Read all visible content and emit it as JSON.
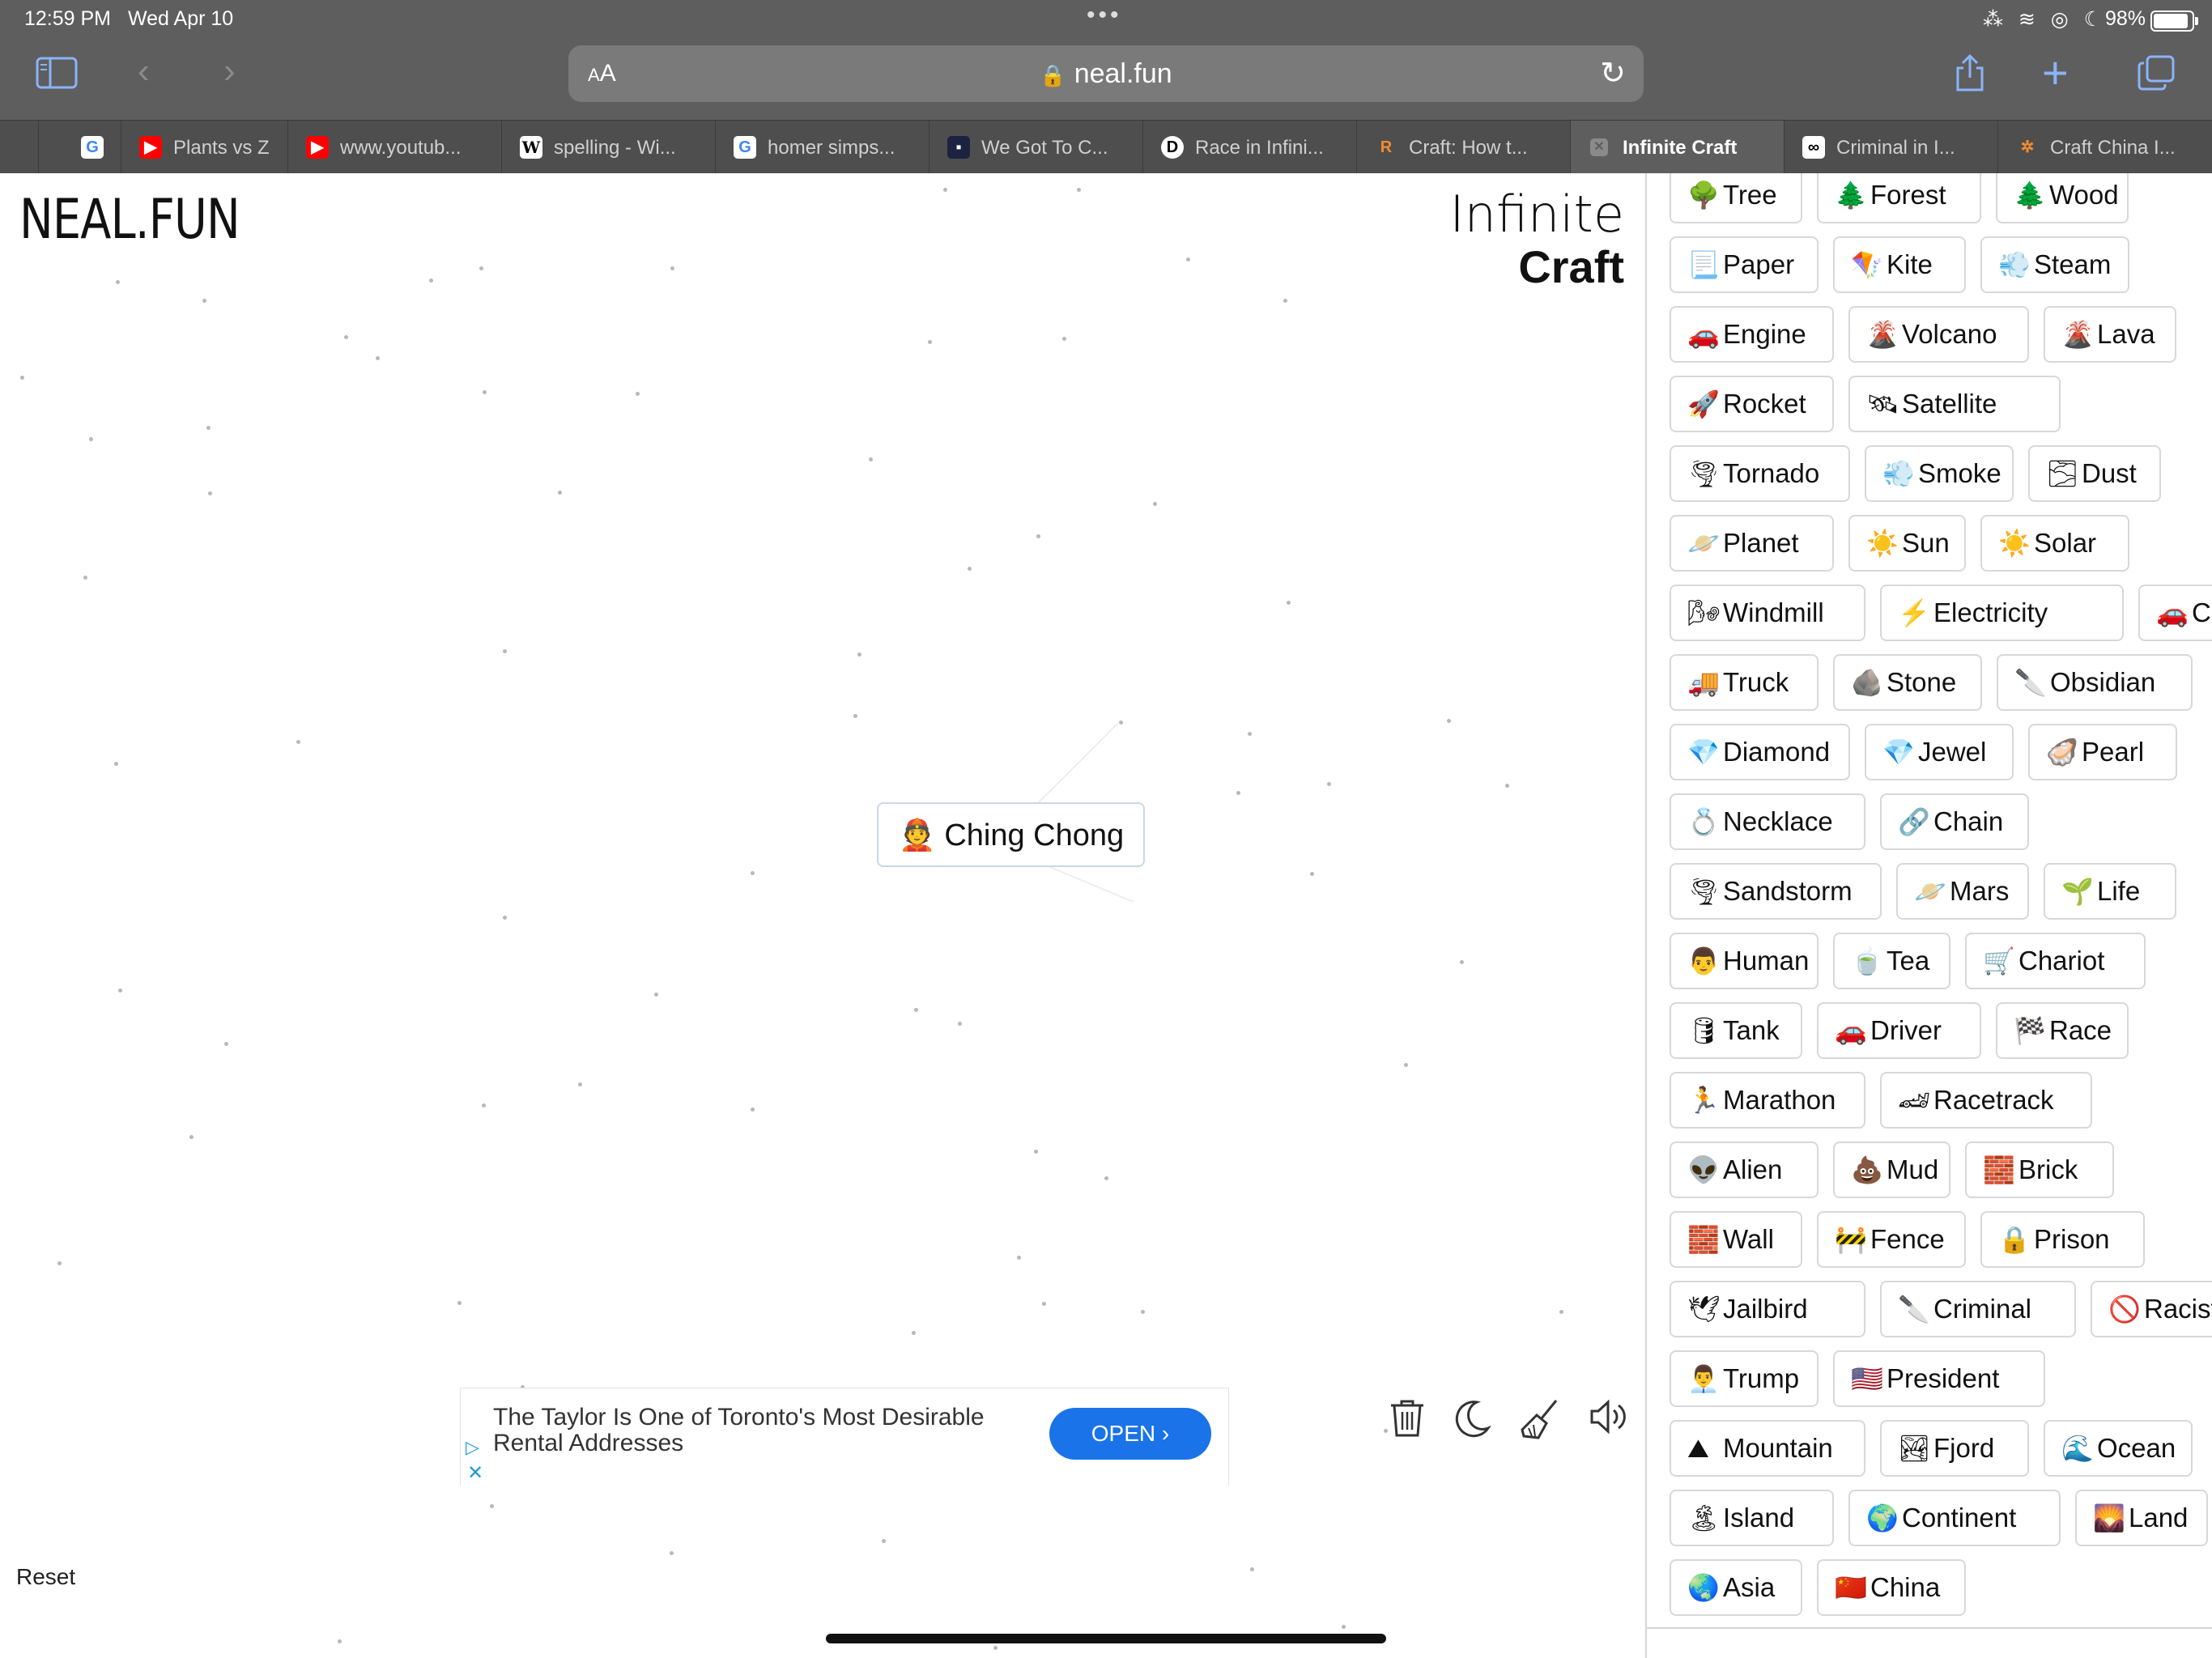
{
  "status_bar": {
    "time": "12:59 PM",
    "date": "Wed Apr 10",
    "battery_percent": "98%",
    "system_icons": "⁂ ≋ ◎ ☾"
  },
  "toolbar": {
    "sidebar_icon": "sidebar-icon",
    "back_icon": "‹",
    "forward_icon": "›",
    "text_size_label": "AA",
    "url": "neal.fun",
    "lock_icon": "🔒",
    "reload_icon": "↻",
    "share_icon": "⇪",
    "new_tab_icon": "+",
    "tabs_icon": "❐"
  },
  "tabs": [
    {
      "label": "",
      "favicon": "G",
      "fav_color": "#ffffff",
      "fav_text": "#4285f4"
    },
    {
      "label": "Plants vs Z",
      "favicon": "▶",
      "fav_color": "#ff0000",
      "fav_text": "#ffffff"
    },
    {
      "label": "www.youtub...",
      "favicon": "▶",
      "fav_color": "#ff0000",
      "fav_text": "#ffffff"
    },
    {
      "label": "spelling - Wi...",
      "favicon": "W",
      "fav_color": "#ffffff",
      "fav_text": "#000000"
    },
    {
      "label": "homer simps...",
      "favicon": "G",
      "fav_color": "#ffffff",
      "fav_text": "#4285f4"
    },
    {
      "label": "We Got To C...",
      "favicon": "▪",
      "fav_color": "#1c2340",
      "fav_text": "#ffffff"
    },
    {
      "label": "Race in Infini...",
      "favicon": "D",
      "fav_color": "#ffffff",
      "fav_text": "#000000"
    },
    {
      "label": "Craft: How t...",
      "favicon": "R",
      "fav_color": "#4e4e4e",
      "fav_text": "#f28b30"
    },
    {
      "label": "Infinite Craft",
      "favicon": "✕",
      "fav_color": "#8a8a8a",
      "fav_text": "#5e5e5e"
    },
    {
      "label": "Criminal in I...",
      "favicon": "∞",
      "fav_color": "#ffffff",
      "fav_text": "#000000"
    },
    {
      "label": "Craft China I...",
      "favicon": "✲",
      "fav_color": "#4e4e4e",
      "fav_text": "#f28b30"
    }
  ],
  "canvas": {
    "logo": "NEAL.FUN",
    "brand_line1": "Infinite",
    "brand_line2": "Craft",
    "item": {
      "emoji": "👲",
      "label": "Ching Chong"
    },
    "reset_label": "Reset"
  },
  "ad": {
    "text": "The Taylor Is One of Toronto's Most Desirable Rental Addresses",
    "button": "OPEN  ›",
    "adchoices_icon": "▷",
    "close_icon": "✕"
  },
  "bottom_icons": {
    "trash": "🗑",
    "theme": "☾",
    "broom": "🧹",
    "sound": "🔈"
  },
  "sidebar_items": [
    [
      {
        "emoji": "🌳",
        "label": "Tree"
      },
      {
        "emoji": "🌲",
        "label": "Forest"
      },
      {
        "emoji": "🌲",
        "label": "Wood"
      }
    ],
    [
      {
        "emoji": "📃",
        "label": "Paper"
      },
      {
        "emoji": "🪁",
        "label": "Kite"
      },
      {
        "emoji": "💨",
        "label": "Steam"
      }
    ],
    [
      {
        "emoji": "🚗",
        "label": "Engine"
      },
      {
        "emoji": "🌋",
        "label": "Volcano"
      },
      {
        "emoji": "🌋",
        "label": "Lava"
      }
    ],
    [
      {
        "emoji": "🚀",
        "label": "Rocket"
      },
      {
        "emoji": "🛰",
        "label": "Satellite"
      }
    ],
    [
      {
        "emoji": "🌪",
        "label": "Tornado"
      },
      {
        "emoji": "💨",
        "label": "Smoke"
      },
      {
        "emoji": "🌫",
        "label": "Dust"
      }
    ],
    [
      {
        "emoji": "🪐",
        "label": "Planet"
      },
      {
        "emoji": "☀️",
        "label": "Sun"
      },
      {
        "emoji": "☀️",
        "label": "Solar"
      }
    ],
    [
      {
        "emoji": "🌬",
        "label": "Windmill"
      },
      {
        "emoji": "⚡",
        "label": "Electricity"
      },
      {
        "emoji": "🚗",
        "label": "Car"
      }
    ],
    [
      {
        "emoji": "🚚",
        "label": "Truck"
      },
      {
        "emoji": "🪨",
        "label": "Stone"
      },
      {
        "emoji": "🔪",
        "label": "Obsidian"
      }
    ],
    [
      {
        "emoji": "💎",
        "label": "Diamond"
      },
      {
        "emoji": "💎",
        "label": "Jewel"
      },
      {
        "emoji": "🦪",
        "label": "Pearl"
      }
    ],
    [
      {
        "emoji": "💍",
        "label": "Necklace"
      },
      {
        "emoji": "🔗",
        "label": "Chain"
      }
    ],
    [
      {
        "emoji": "🌪",
        "label": "Sandstorm"
      },
      {
        "emoji": "🪐",
        "label": "Mars"
      },
      {
        "emoji": "🌱",
        "label": "Life"
      }
    ],
    [
      {
        "emoji": "👨",
        "label": "Human"
      },
      {
        "emoji": "🍵",
        "label": "Tea"
      },
      {
        "emoji": "🛒",
        "label": "Chariot"
      }
    ],
    [
      {
        "emoji": "🛢",
        "label": "Tank"
      },
      {
        "emoji": "🚗",
        "label": "Driver"
      },
      {
        "emoji": "🏁",
        "label": "Race"
      }
    ],
    [
      {
        "emoji": "🏃",
        "label": "Marathon"
      },
      {
        "emoji": "🏎",
        "label": "Racetrack"
      }
    ],
    [
      {
        "emoji": "👽",
        "label": "Alien"
      },
      {
        "emoji": "💩",
        "label": "Mud"
      },
      {
        "emoji": "🧱",
        "label": "Brick"
      }
    ],
    [
      {
        "emoji": "🧱",
        "label": "Wall"
      },
      {
        "emoji": "🚧",
        "label": "Fence"
      },
      {
        "emoji": "🔒",
        "label": "Prison"
      }
    ],
    [
      {
        "emoji": "🕊",
        "label": "Jailbird"
      },
      {
        "emoji": "🔪",
        "label": "Criminal"
      },
      {
        "emoji": "🚫",
        "label": "Racist"
      }
    ],
    [
      {
        "emoji": "👨‍💼",
        "label": "Trump"
      },
      {
        "emoji": "🇺🇸",
        "label": "President"
      }
    ],
    [
      {
        "emoji": "⛰",
        "label": "Mountain"
      },
      {
        "emoji": "🏞",
        "label": "Fjord"
      },
      {
        "emoji": "🌊",
        "label": "Ocean"
      }
    ],
    [
      {
        "emoji": "🏝",
        "label": "Island"
      },
      {
        "emoji": "🌍",
        "label": "Continent"
      },
      {
        "emoji": "🌄",
        "label": "Land"
      }
    ],
    [
      {
        "emoji": "🌏",
        "label": "Asia"
      },
      {
        "emoji": "🇨🇳",
        "label": "China"
      }
    ]
  ]
}
